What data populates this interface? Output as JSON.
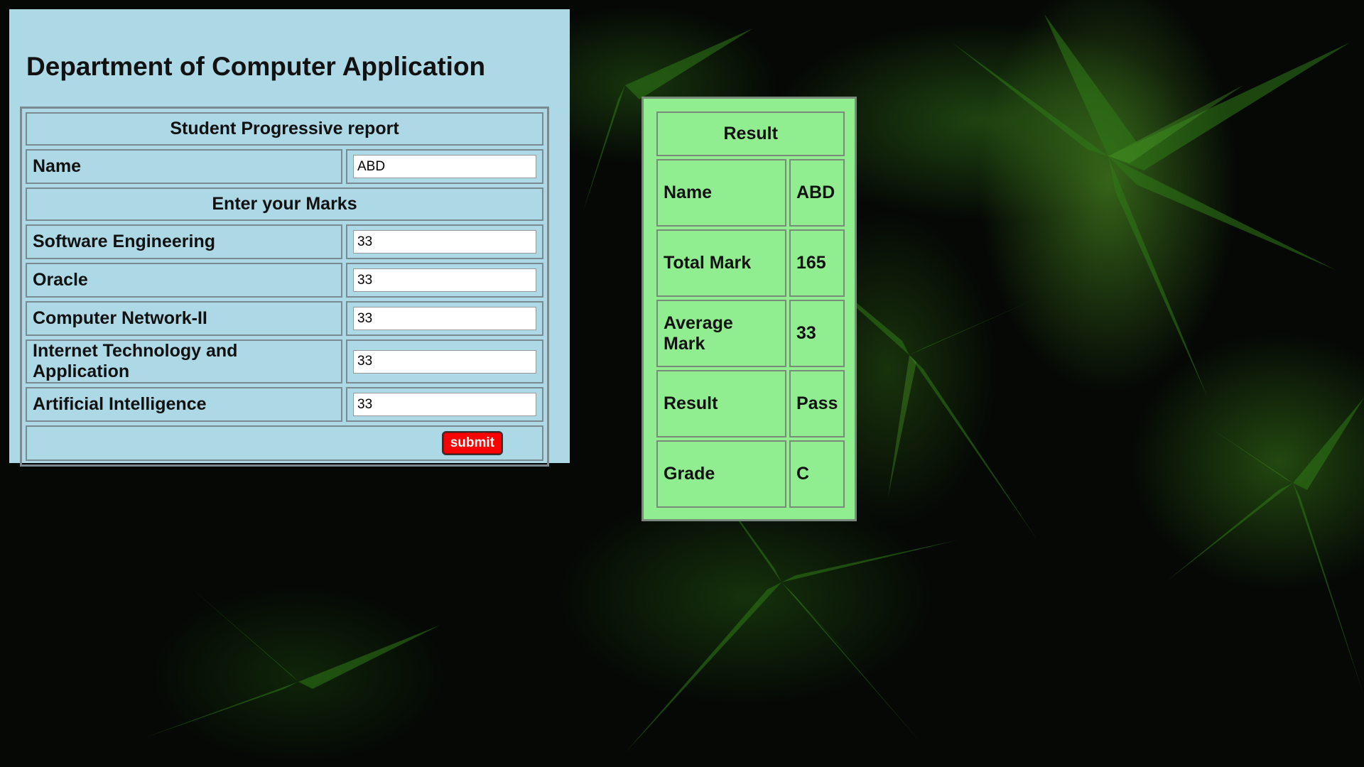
{
  "page": {
    "title": "Department of Computer Application"
  },
  "form": {
    "header": "Student Progressive report",
    "name_label": "Name",
    "name_value": "ABD",
    "marks_header": "Enter your Marks",
    "subjects": [
      {
        "label": "Software Engineering",
        "value": "33"
      },
      {
        "label": "Oracle",
        "value": "33"
      },
      {
        "label": "Computer Network-II",
        "value": "33"
      },
      {
        "label": "Internet Technology and Application",
        "value": "33"
      },
      {
        "label": "Artificial Intelligence",
        "value": "33"
      }
    ],
    "submit_label": "submit"
  },
  "result": {
    "header": "Result",
    "rows": [
      {
        "label": "Name",
        "value": "ABD"
      },
      {
        "label": "Total Mark",
        "value": "165"
      },
      {
        "label": "Average Mark",
        "value": "33"
      },
      {
        "label": "Result",
        "value": "Pass"
      },
      {
        "label": "Grade",
        "value": "C"
      }
    ]
  },
  "colors": {
    "form_panel_bg": "#add8e6",
    "result_panel_bg": "#90ee90",
    "submit_button_bg": "#ff0000",
    "background": "#050805",
    "leaf_green": "#3a8a1e"
  }
}
